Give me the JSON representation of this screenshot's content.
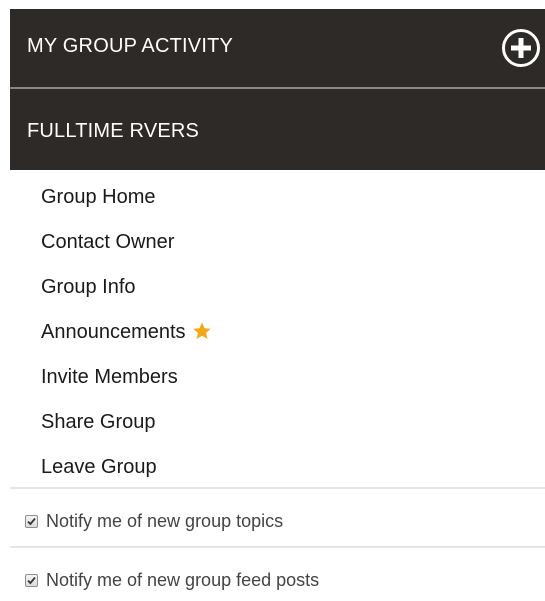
{
  "colors": {
    "header_bg": "#2e2a27",
    "header_text": "#ffffff",
    "star": "#f3a81c",
    "link_text": "#1a1a1a",
    "notify_text": "#444444"
  },
  "activity_header": {
    "title": "MY GROUP ACTIVITY",
    "add_icon": "plus-circle-icon"
  },
  "group_header": {
    "title": "FULLTIME RVERS"
  },
  "nav": {
    "items": [
      {
        "label": "Group Home"
      },
      {
        "label": "Contact Owner"
      },
      {
        "label": "Group Info"
      },
      {
        "label": "Announcements",
        "icon": "star-icon"
      },
      {
        "label": "Invite Members"
      },
      {
        "label": "Share Group"
      },
      {
        "label": "Leave Group"
      }
    ]
  },
  "notifications": {
    "topics": {
      "label": "Notify me of new group topics",
      "checked": true
    },
    "feed_posts": {
      "label": "Notify me of new group feed posts",
      "checked": true
    }
  }
}
